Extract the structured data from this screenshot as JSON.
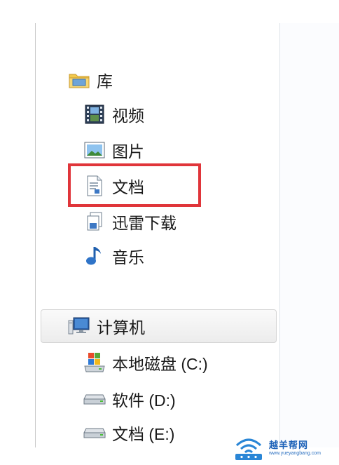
{
  "nav": {
    "libraries": {
      "label": "库",
      "items": [
        {
          "label": "视频",
          "icon": "video-library-icon"
        },
        {
          "label": "图片",
          "icon": "pictures-library-icon"
        },
        {
          "label": "文档",
          "icon": "documents-library-icon"
        },
        {
          "label": "迅雷下载",
          "icon": "thunder-download-library-icon"
        },
        {
          "label": "音乐",
          "icon": "music-library-icon"
        }
      ]
    },
    "computer": {
      "label": "计算机",
      "drives": [
        {
          "label": "本地磁盘 (C:)",
          "icon": "system-drive-icon"
        },
        {
          "label": "软件 (D:)",
          "icon": "drive-icon"
        },
        {
          "label": "文档 (E:)",
          "icon": "drive-icon"
        }
      ]
    }
  },
  "annotation": {
    "highlighted_item": "文档",
    "color": "#e0353a"
  },
  "watermark": {
    "title": "越羊帮网",
    "url": "www.yueyangbang.com"
  },
  "colors": {
    "selection_bg": "#ececec",
    "folder_yellow": "#e8b83a",
    "accent_blue": "#1d62b8"
  }
}
